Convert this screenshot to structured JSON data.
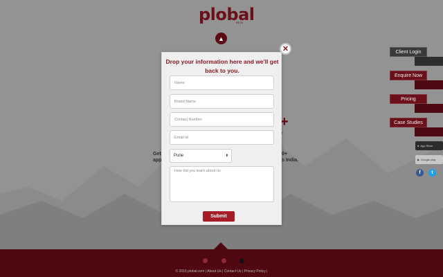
{
  "background": {
    "logo": {
      "text": "plobal",
      "beta": "BETA"
    },
    "text_left_1": "Get",
    "text_left_2": "app",
    "text_right_1": "0+",
    "text_right_2": "s India.",
    "side_buttons": [
      {
        "label": "Client Login",
        "style": "dark"
      },
      {
        "label": "Enquire Now",
        "style": "red"
      },
      {
        "label": "Pricing",
        "style": "red"
      },
      {
        "label": "Case Studies",
        "style": "red"
      }
    ],
    "stores": {
      "app_store": "App Store",
      "google_play": "Google play"
    },
    "footer": {
      "links": "© 2016 plobal.com | About Us | Contact Us | Privacy Policy |"
    }
  },
  "modal": {
    "title": "Drop your information here and we'll get back to you.",
    "fields": {
      "name_placeholder": "Name",
      "brand_placeholder": "Brand Name",
      "contact_placeholder": "Contact Number",
      "email_placeholder": "Email Id"
    },
    "city_select": {
      "value": "Pune"
    },
    "textarea_placeholder": "How did you learn about us",
    "submit_label": "Submit"
  },
  "colors": {
    "accent": "#a61b25",
    "brand": "#6b0f1a",
    "footer": "#4f0810"
  }
}
